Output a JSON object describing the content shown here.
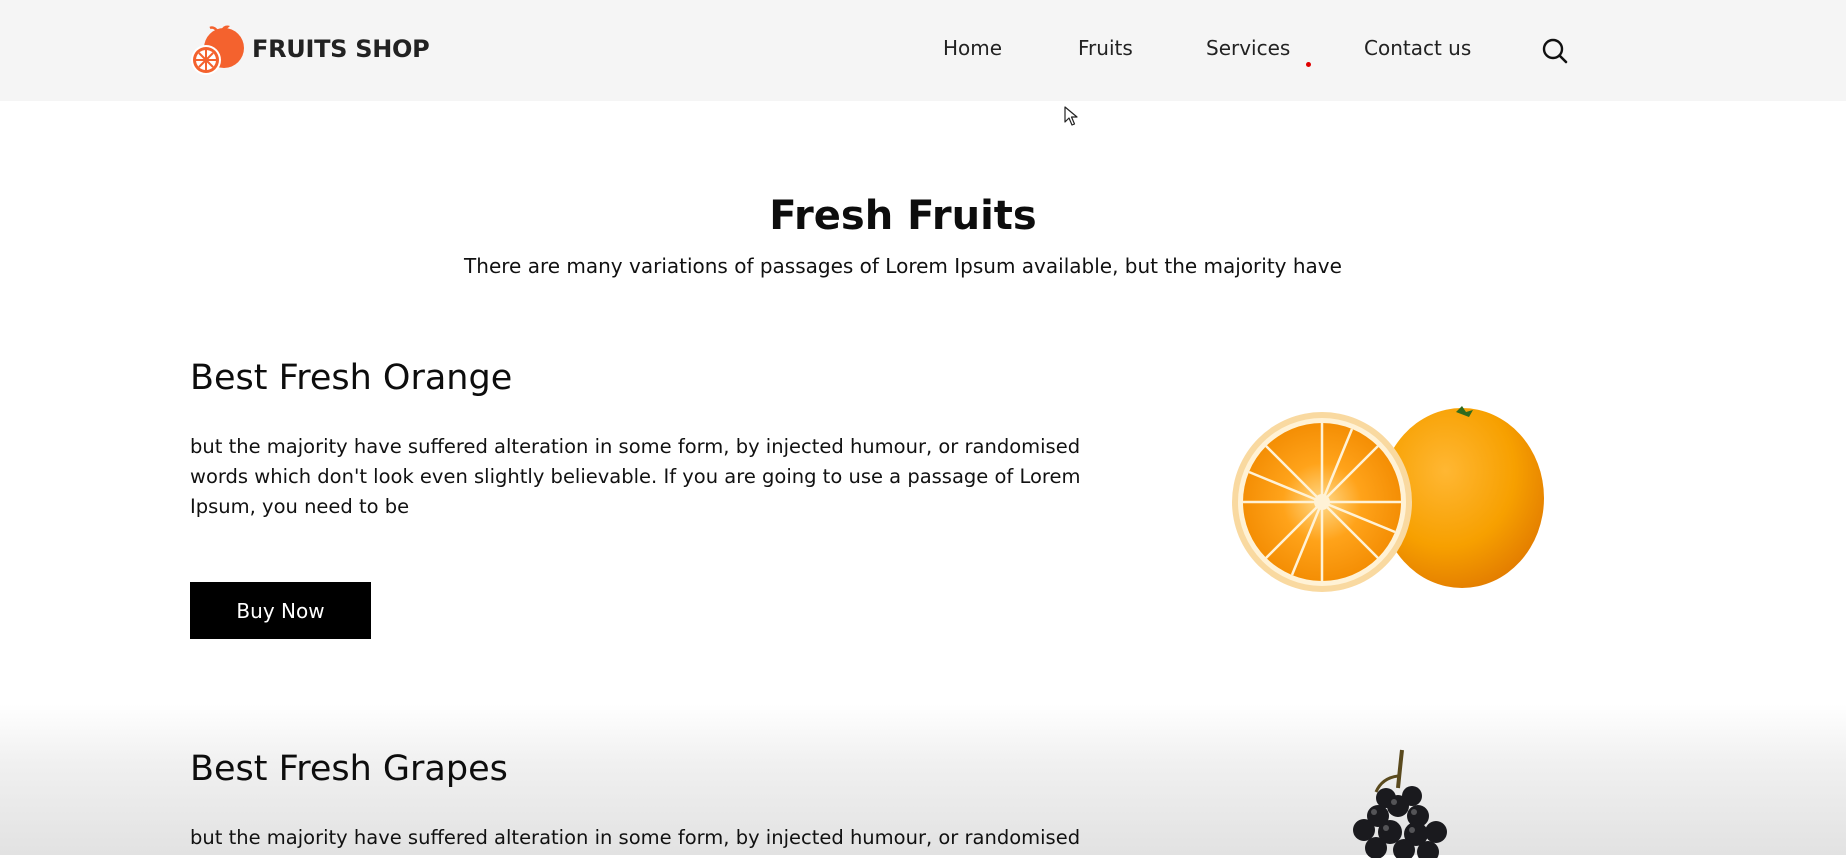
{
  "brand": {
    "name": "FRUITS SHOP",
    "logo_icon": "orange-fruit-logo"
  },
  "nav": {
    "items": [
      {
        "label": "Home"
      },
      {
        "label": "Fruits"
      },
      {
        "label": "Services"
      },
      {
        "label": "Contact us"
      }
    ],
    "search_icon": "search-icon"
  },
  "section": {
    "title": "Fresh Fruits",
    "subtitle": "There are many variations of passages of Lorem Ipsum available, but the majority have"
  },
  "products": [
    {
      "title": "Best Fresh Orange",
      "description": "but the majority have suffered alteration in some form, by injected humour, or randomised words which don't look even slightly believable. If you are going to use a passage of Lorem Ipsum, you need to be",
      "button_label": "Buy Now",
      "image": "orange-image"
    },
    {
      "title": "Best Fresh Grapes",
      "description": "but the majority have suffered alteration in some form, by injected humour, or randomised",
      "image": "grapes-image"
    }
  ],
  "colors": {
    "brand_orange": "#F4622E",
    "header_bg": "#F5F5F5",
    "nav_dot": "#E00000",
    "button_bg": "#000000",
    "button_text": "#FFFFFF"
  }
}
